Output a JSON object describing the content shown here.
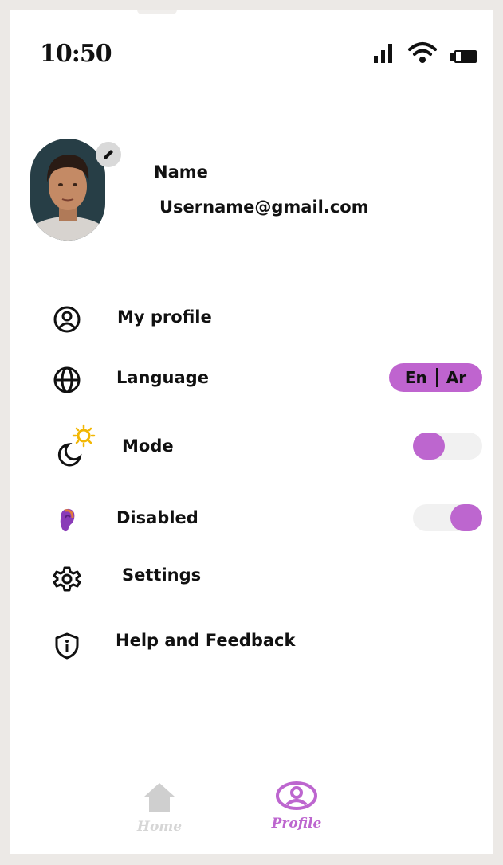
{
  "status_bar": {
    "time": "10:50"
  },
  "profile": {
    "name": "Name",
    "email": "Username@gmail.com"
  },
  "menu": {
    "my_profile": "My profile",
    "language": "Language",
    "lang_en": "En",
    "lang_ar": "Ar",
    "mode": "Mode",
    "disabled": "Disabled",
    "settings": "Settings",
    "help": "Help and Feedback"
  },
  "toggles": {
    "mode_on": false,
    "disabled_on": true
  },
  "bottom_nav": {
    "home": "Home",
    "profile": "Profile",
    "active": "profile"
  },
  "colors": {
    "accent": "#bd66cf",
    "inactive": "#d6d6d6",
    "toggle_track": "#f1f1f1"
  }
}
